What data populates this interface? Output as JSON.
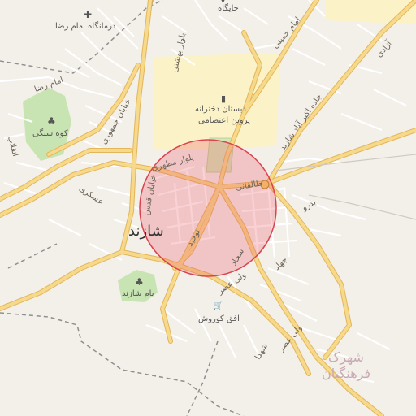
{
  "map": {
    "city_label": "شازند",
    "colors": {
      "background": "#f3efe9",
      "major_road": "#f6d98a",
      "major_road_casing": "#e3b65a",
      "minor_road": "#ffffff",
      "park": "#c9e4b3",
      "area_highlight": "#fbf2c8",
      "boundary": "#8f8f8f",
      "circle_fill": "#ee5a68",
      "circle_stroke": "#d9434f"
    },
    "labels": {
      "poi_top": "جایگاه",
      "clinic": "درمانگاه امام رضا",
      "school_line1": "دبستان دخترانه",
      "school_line2": "پروین اعتصامی",
      "kuh_sangi": "کوه سنگی",
      "bam_shazand": "بام شازند",
      "ofogh_kourosh": "افق کوروش",
      "shahrak_line1": "شهرک",
      "shahrak_line2": "فرهنگیان"
    },
    "roads": {
      "imam_reza": "امام رضا",
      "khiaban_jomhouri": "خیابان جمهوری",
      "bolvar_beheshti": "بلوار بهشتی",
      "imam_khomeini": "امام خمینی",
      "azadi": "آزادی",
      "jadeh_akbarabad": "جاده اکبر آباد شازند",
      "bolvar_motahari": "بلوار مطهری",
      "taleghani": "طالقانی",
      "khiaban_ghods": "خیابان قدس",
      "askari": "عسکری",
      "enghelab": "انقلاب",
      "tohid": "توحید",
      "sajjad": "سجاد",
      "jahad": "جهاد",
      "vali_asr_1": "ولی عصر",
      "vali_asr_2": "ولی عصر",
      "shohada": "شهدا",
      "road_lbl_right": "بدرو"
    },
    "icons": {
      "clinic": "cross-icon",
      "school": "school-icon",
      "kuh_sangi": "tree-icon",
      "bam_shazand": "tree-icon",
      "ofogh_kourosh": "shop-icon",
      "circle_center": "location-marker-icon"
    }
  }
}
